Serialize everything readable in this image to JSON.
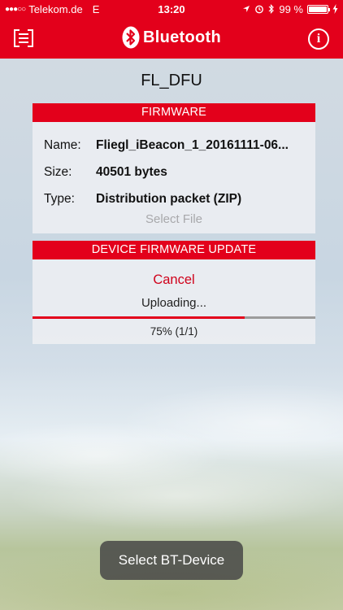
{
  "status_bar": {
    "signal_dots": "●●●○○",
    "carrier": "Telekom.de",
    "network": "E",
    "time": "13:20",
    "battery_percent": "99 %",
    "battery_level": 0.99
  },
  "nav": {
    "title": "Bluetooth",
    "info_symbol": "i"
  },
  "device_name": "FL_DFU",
  "firmware": {
    "header": "FIRMWARE",
    "rows": [
      {
        "label": "Name:",
        "value": "Fliegl_iBeacon_1_20161111-06..."
      },
      {
        "label": "Size:",
        "value": "40501 bytes"
      },
      {
        "label": "Type:",
        "value": "Distribution packet (ZIP)"
      }
    ],
    "select_file": "Select File"
  },
  "dfu": {
    "header": "DEVICE FIRMWARE UPDATE",
    "cancel": "Cancel",
    "status": "Uploading...",
    "progress": 0.75,
    "progress_text": "75% (1/1)"
  },
  "bottom": {
    "select_device": "Select BT-Device"
  },
  "colors": {
    "brand_red": "#e3001b",
    "cancel_red": "#d0021b"
  }
}
